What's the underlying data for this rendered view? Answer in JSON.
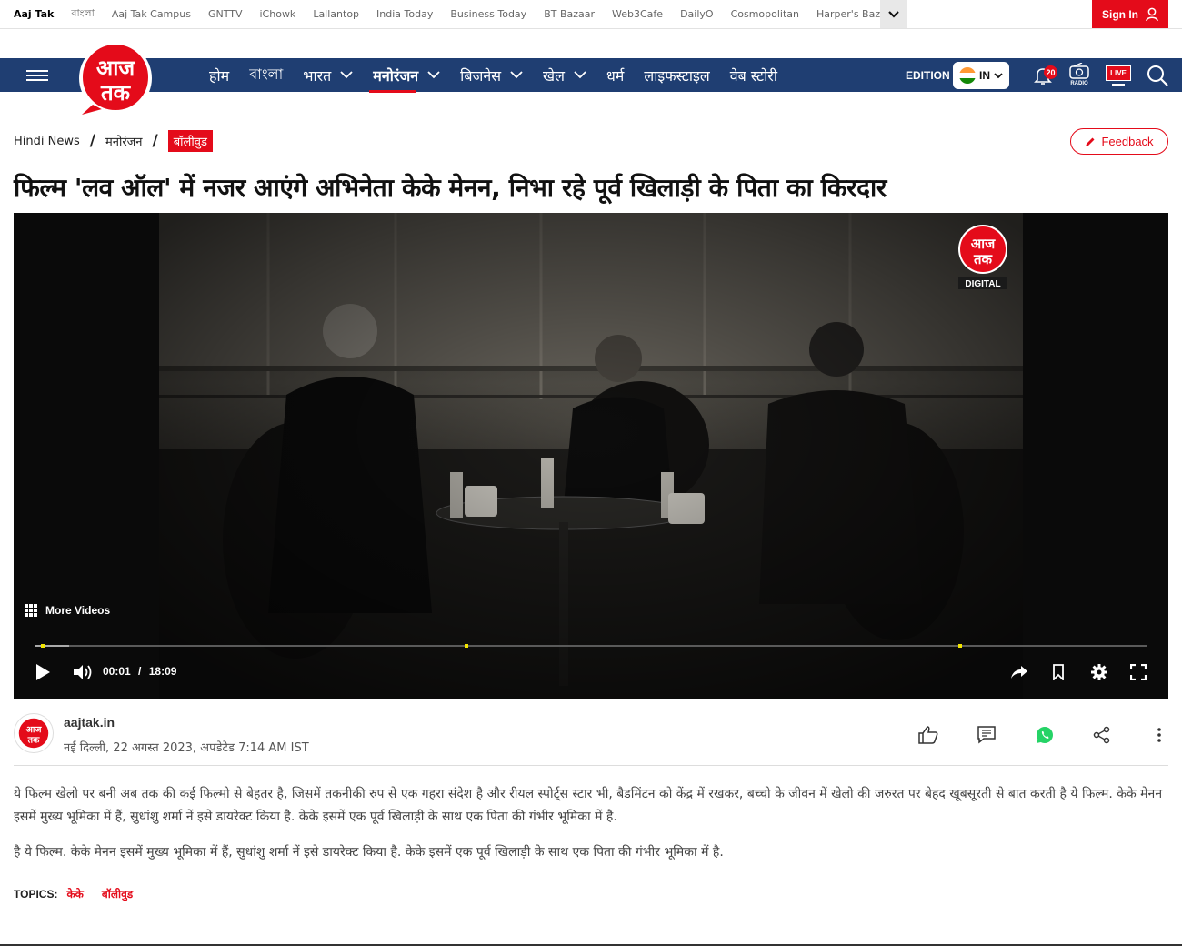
{
  "network_links": [
    "Aaj Tak",
    "বাংলা",
    "Aaj Tak Campus",
    "GNTTV",
    "iChowk",
    "Lallantop",
    "India Today",
    "Business Today",
    "BT Bazaar",
    "Web3Cafe",
    "DailyO",
    "Cosmopolitan",
    "Harper's Bazaar"
  ],
  "signin_label": "Sign In",
  "logo_text": {
    "line1": "आज",
    "line2": "तक"
  },
  "nav": [
    {
      "label": "होम",
      "chevron": false,
      "active": false
    },
    {
      "label": "বাংলা",
      "chevron": false,
      "active": false
    },
    {
      "label": "भारत",
      "chevron": true,
      "active": false
    },
    {
      "label": "मनोरंजन",
      "chevron": true,
      "active": true
    },
    {
      "label": "बिजनेस",
      "chevron": true,
      "active": false
    },
    {
      "label": "खेल",
      "chevron": true,
      "active": false
    },
    {
      "label": "धर्म",
      "chevron": false,
      "active": false
    },
    {
      "label": "लाइफस्टाइल",
      "chevron": false,
      "active": false
    },
    {
      "label": "वेब स्टोरी",
      "chevron": false,
      "active": false
    }
  ],
  "edition_label": "EDITION",
  "edition_value": "IN",
  "notification_count": "20",
  "radio_label": "RADIO",
  "live_label": "LIVE",
  "breadcrumb": [
    "Hindi News",
    "मनोरंजन",
    "बॉलीवुड"
  ],
  "feedback_label": "Feedback",
  "headline": "फिल्म 'लव ऑल' में नजर आएंगे अभिनेता केके मेनन, निभा रहे पूर्व खिलाड़ी के पिता का किरदार",
  "video": {
    "watermark": {
      "line1": "आज",
      "line2": "तक",
      "tag": "DIGITAL"
    },
    "more_videos_label": "More Videos",
    "current_time": "00:01",
    "time_separator": "/",
    "duration": "18:09",
    "progress_fraction": 0.001,
    "buffered_fraction": 0.03,
    "marker_fractions": [
      0.005,
      0.386,
      0.831
    ],
    "marker_color": "#f2e500"
  },
  "author": {
    "name": "aajtak.in",
    "dateline": "नई दिल्ली, 22 अगस्त 2023, अपडेटेड 7:14 AM IST"
  },
  "action_icons": [
    "like-icon",
    "comment-icon",
    "whatsapp-icon",
    "share-icon",
    "more-options-icon"
  ],
  "paragraphs": [
    "ये फिल्म खेलो पर बनी अब तक की कई फिल्मो से बेहतर है, जिसमें तकनीकी रुप से एक गहरा संदेश है और रीयल स्पोर्ट्स स्टार भी, बैडमिंटन को केंद्र में रखकर, बच्चो के जीवन में खेलो की जरुरत पर बेहद खूबसूरती से बात करती है ये फिल्म. केके मेनन इसमें मुख्य भूमिका में हैं, सुधांशु शर्मा नें इसे डायरेक्ट किया है. केके इसमें एक पूर्व खिलाड़ी के साथ एक पिता की गंभीर भूमिका में है.",
    "है ये फिल्म. केके मेनन इसमें मुख्य भूमिका में हैं, सुधांशु शर्मा नें इसे डायरेक्ट किया है. केके इसमें एक पूर्व खिलाड़ी के साथ एक पिता की गंभीर भूमिका में है."
  ],
  "topics_label": "TOPICS:",
  "topics": [
    "केके",
    "बॉलीवुड"
  ],
  "colors": {
    "brand_red": "#e40b1a",
    "nav_blue": "#1f3e72",
    "whatsapp_green": "#25d366"
  }
}
